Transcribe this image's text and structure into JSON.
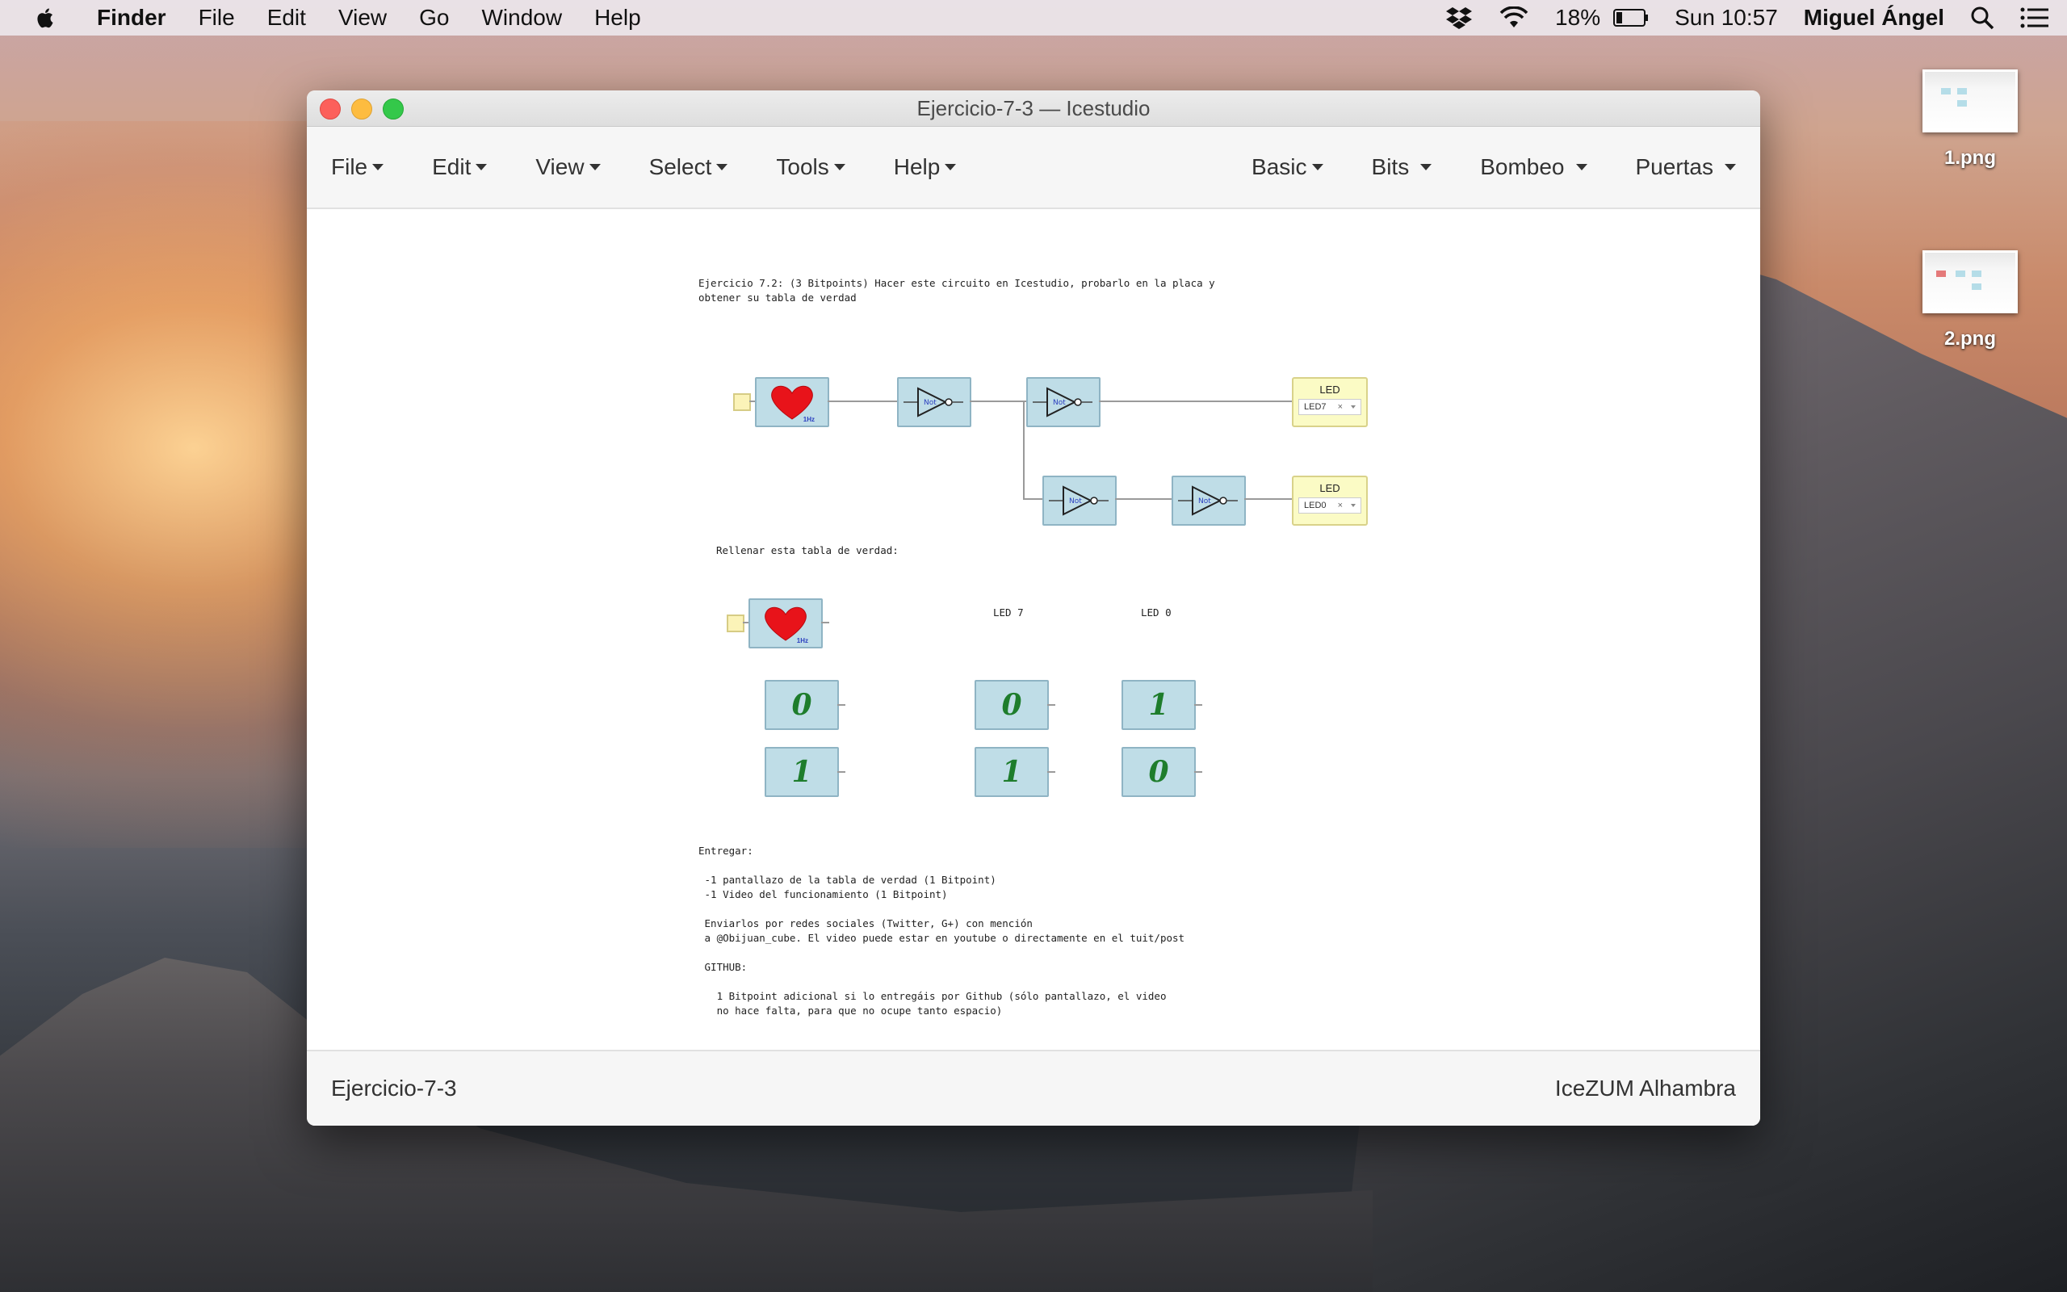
{
  "menubar": {
    "app_name": "Finder",
    "items": [
      "File",
      "Edit",
      "View",
      "Go",
      "Window",
      "Help"
    ],
    "battery": "18%",
    "clock": "Sun 10:57",
    "user": "Miguel Ángel"
  },
  "desktop": {
    "files": [
      {
        "name": "1.png"
      },
      {
        "name": "2.png"
      }
    ]
  },
  "window": {
    "title": "Ejercicio-7-3 — Icestudio",
    "menus_left": [
      "File",
      "Edit",
      "View",
      "Select",
      "Tools",
      "Help"
    ],
    "menus_right": [
      "Basic",
      "Bits",
      "Bombeo",
      "Puertas"
    ],
    "canvas": {
      "intro_text": "Ejercicio 7.2: (3 Bitpoints) Hacer este circuito en Icestudio, probarlo en la placa y\nobtener su tabla de verdad",
      "gate_label": "Not",
      "clock_label": "1Hz",
      "leds": [
        {
          "label": "LED",
          "value": "LED7"
        },
        {
          "label": "LED",
          "value": "LED0"
        }
      ],
      "table_title": "Rellenar esta tabla de verdad:",
      "table_headers": [
        "LED 7",
        "LED 0"
      ],
      "truth_table": [
        [
          "0",
          "0",
          "1"
        ],
        [
          "1",
          "1",
          "0"
        ]
      ],
      "deliver_text": "Entregar:\n\n -1 pantallazo de la tabla de verdad (1 Bitpoint)\n -1 Video del funcionamiento (1 Bitpoint)\n\n Enviarlos por redes sociales (Twitter, G+) con mención\n a @Obijuan_cube. El video puede estar en youtube o directamente en el tuit/post\n\n GITHUB:\n\n   1 Bitpoint adicional si lo entregáis por Github (sólo pantallazo, el video\n   no hace falta, para que no ocupe tanto espacio)"
    },
    "status_left": "Ejercicio-7-3",
    "status_right": "IceZUM Alhambra"
  },
  "colors": {
    "block_fill": "#bfdde7",
    "led_fill": "#fbfbc5",
    "bit_text": "#1e7d2c",
    "heart": "#e8131a"
  }
}
